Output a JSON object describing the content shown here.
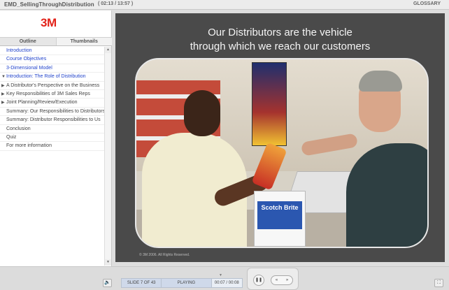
{
  "header": {
    "title": "EMD_SellingThroughDistribution",
    "time": "( 02:13 / 13:57 )",
    "glossary": "GLOSSARY"
  },
  "sidebar": {
    "logo": "3M",
    "tabs": [
      "Outline",
      "Thumbnails"
    ],
    "items": [
      {
        "label": "Introduction",
        "link": true,
        "arrow": ""
      },
      {
        "label": "Course Objectives",
        "link": true,
        "arrow": ""
      },
      {
        "label": "3-Dimensional Model",
        "link": true,
        "arrow": ""
      },
      {
        "label": "Introduction: The Role of Distribution",
        "link": true,
        "arrow": "▼"
      },
      {
        "label": "A Distributor's Perspective on the Business",
        "link": false,
        "arrow": "▶"
      },
      {
        "label": "Key Responsibilities of 3M Sales Reps",
        "link": false,
        "arrow": "▶"
      },
      {
        "label": "Joint Planning/Review/Execution",
        "link": false,
        "arrow": "▶"
      },
      {
        "label": "Summary: Our Responsibilities to  Distributors",
        "link": false,
        "arrow": ""
      },
      {
        "label": "Summary: Distributor Responsibilities to Us",
        "link": false,
        "arrow": ""
      },
      {
        "label": "Conclusion",
        "link": false,
        "arrow": ""
      },
      {
        "label": "Quiz",
        "link": false,
        "arrow": ""
      },
      {
        "label": "For more information",
        "link": false,
        "arrow": ""
      }
    ],
    "scroll_up": "▲",
    "scroll_down": "▼"
  },
  "slide": {
    "title_line1": "Our Distributors are the vehicle",
    "title_line2": "through which we reach our customers",
    "copyright": "© 3M 2006.  All Rights Reserved.",
    "box_brand": "Scotch Brite"
  },
  "controls": {
    "volume_icon": "🔈",
    "slide_counter": "SLIDE 7 OF 43",
    "state": "PLAYING",
    "slide_time": "00:07 / 00:08",
    "marker": "▼",
    "pause": "❚❚",
    "prev": "«",
    "next": "»",
    "fullscreen": "⛶"
  }
}
